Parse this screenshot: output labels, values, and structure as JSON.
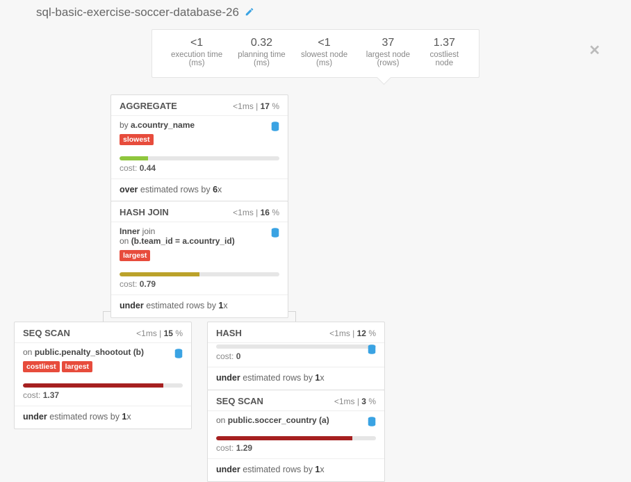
{
  "title": "sql-basic-exercise-soccer-database-26",
  "stats": [
    {
      "val": "<1",
      "label": "execution time (ms)"
    },
    {
      "val": "0.32",
      "label": "planning time (ms)"
    },
    {
      "val": "<1",
      "label": "slowest node (ms)"
    },
    {
      "val": "37",
      "label": "largest node (rows)"
    },
    {
      "val": "1.37",
      "label": "costliest node"
    }
  ],
  "nodes": {
    "agg": {
      "title": "AGGREGATE",
      "time": "<1ms",
      "pct": "17",
      "sub_pre": "by ",
      "sub_b": "a.country_name",
      "badges": [
        "slowest"
      ],
      "bar_pct": 18,
      "bar_cls": "bar-green",
      "cost": "0.44",
      "est_pre": "over",
      "est_mid": " estimated rows by ",
      "est_x": "6"
    },
    "hj": {
      "title": "HASH JOIN",
      "time": "<1ms",
      "pct": "16",
      "line1_pre": "Inner",
      "line1_post": " join",
      "line2_pre": "on ",
      "line2_b": "(b.team_id = a.country_id)",
      "badges": [
        "largest"
      ],
      "bar_pct": 50,
      "bar_cls": "bar-olive",
      "cost": "0.79",
      "est_pre": "under",
      "est_mid": " estimated rows by ",
      "est_x": "1"
    },
    "ss1": {
      "title": "SEQ SCAN",
      "time": "<1ms",
      "pct": "15",
      "sub_pre": "on ",
      "sub_b": "public.penalty_shootout (b)",
      "badges": [
        "costliest",
        "largest"
      ],
      "bar_pct": 88,
      "bar_cls": "bar-red",
      "cost": "1.37",
      "est_pre": "under",
      "est_mid": " estimated rows by ",
      "est_x": "1"
    },
    "hash": {
      "title": "HASH",
      "time": "<1ms",
      "pct": "12",
      "bar_pct": 0,
      "bar_cls": "bar-red",
      "cost": "0",
      "est_pre": "under",
      "est_mid": " estimated rows by ",
      "est_x": "1"
    },
    "ss2": {
      "title": "SEQ SCAN",
      "time": "<1ms",
      "pct": "3",
      "sub_pre": "on ",
      "sub_b": "public.soccer_country (a)",
      "bar_pct": 85,
      "bar_cls": "bar-red",
      "cost": "1.29",
      "est_pre": "under",
      "est_mid": " estimated rows by ",
      "est_x": "1"
    }
  },
  "labels": {
    "cost": "cost: ",
    "x_suffix": "x",
    "sep": " | ",
    "pct": " %"
  },
  "chart_data": {
    "type": "table",
    "title": "sql-basic-exercise-soccer-database-26 query plan",
    "stats": {
      "execution_time_ms": "<1",
      "planning_time_ms": 0.32,
      "slowest_node_ms": "<1",
      "largest_node_rows": 37,
      "costliest_node": 1.37
    },
    "tree": {
      "node": "AGGREGATE",
      "time_ms": "<1",
      "pct": 17,
      "cost": 0.44,
      "rows_estimate": "over 6x",
      "flags": [
        "slowest"
      ],
      "detail": "by a.country_name",
      "children": [
        {
          "node": "HASH JOIN",
          "time_ms": "<1",
          "pct": 16,
          "cost": 0.79,
          "rows_estimate": "under 1x",
          "flags": [
            "largest"
          ],
          "detail": "Inner join on (b.team_id = a.country_id)",
          "children": [
            {
              "node": "SEQ SCAN",
              "time_ms": "<1",
              "pct": 15,
              "cost": 1.37,
              "rows_estimate": "under 1x",
              "flags": [
                "costliest",
                "largest"
              ],
              "detail": "on public.penalty_shootout (b)"
            },
            {
              "node": "HASH",
              "time_ms": "<1",
              "pct": 12,
              "cost": 0,
              "rows_estimate": "under 1x",
              "children": [
                {
                  "node": "SEQ SCAN",
                  "time_ms": "<1",
                  "pct": 3,
                  "cost": 1.29,
                  "rows_estimate": "under 1x",
                  "detail": "on public.soccer_country (a)"
                }
              ]
            }
          ]
        }
      ]
    }
  }
}
